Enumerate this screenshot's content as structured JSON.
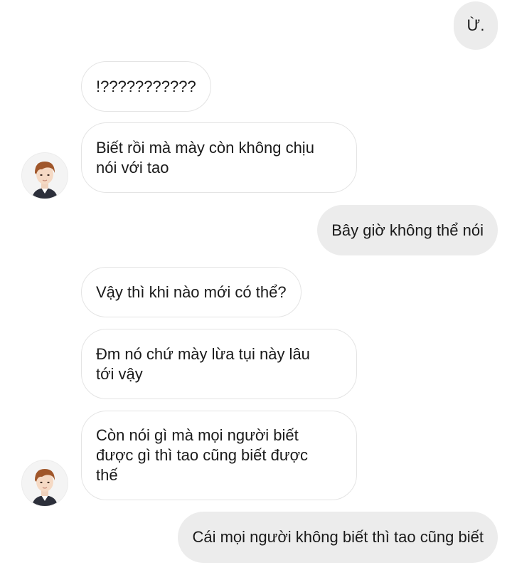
{
  "messages": [
    {
      "side": "outgoing",
      "text": "Ừ."
    },
    {
      "side": "incoming",
      "text": "!???????????"
    },
    {
      "side": "incoming",
      "text": "Biết rồi mà mày còn không chịu\nnói với tao"
    },
    {
      "side": "outgoing",
      "text": "Bây giờ không thể nói"
    },
    {
      "side": "incoming",
      "text": "Vậy thì khi nào mới có thể?"
    },
    {
      "side": "incoming",
      "text": "Đm nó chứ mày lừa tụi này lâu\ntới vậy"
    },
    {
      "side": "incoming",
      "text": "Còn nói gì mà mọi người biết\nđược gì thì tao cũng biết được\nthế"
    },
    {
      "side": "outgoing",
      "text": "Cái mọi người không biết thì tao cũng biết"
    }
  ],
  "avatar_icon": "profile-photo-icon"
}
